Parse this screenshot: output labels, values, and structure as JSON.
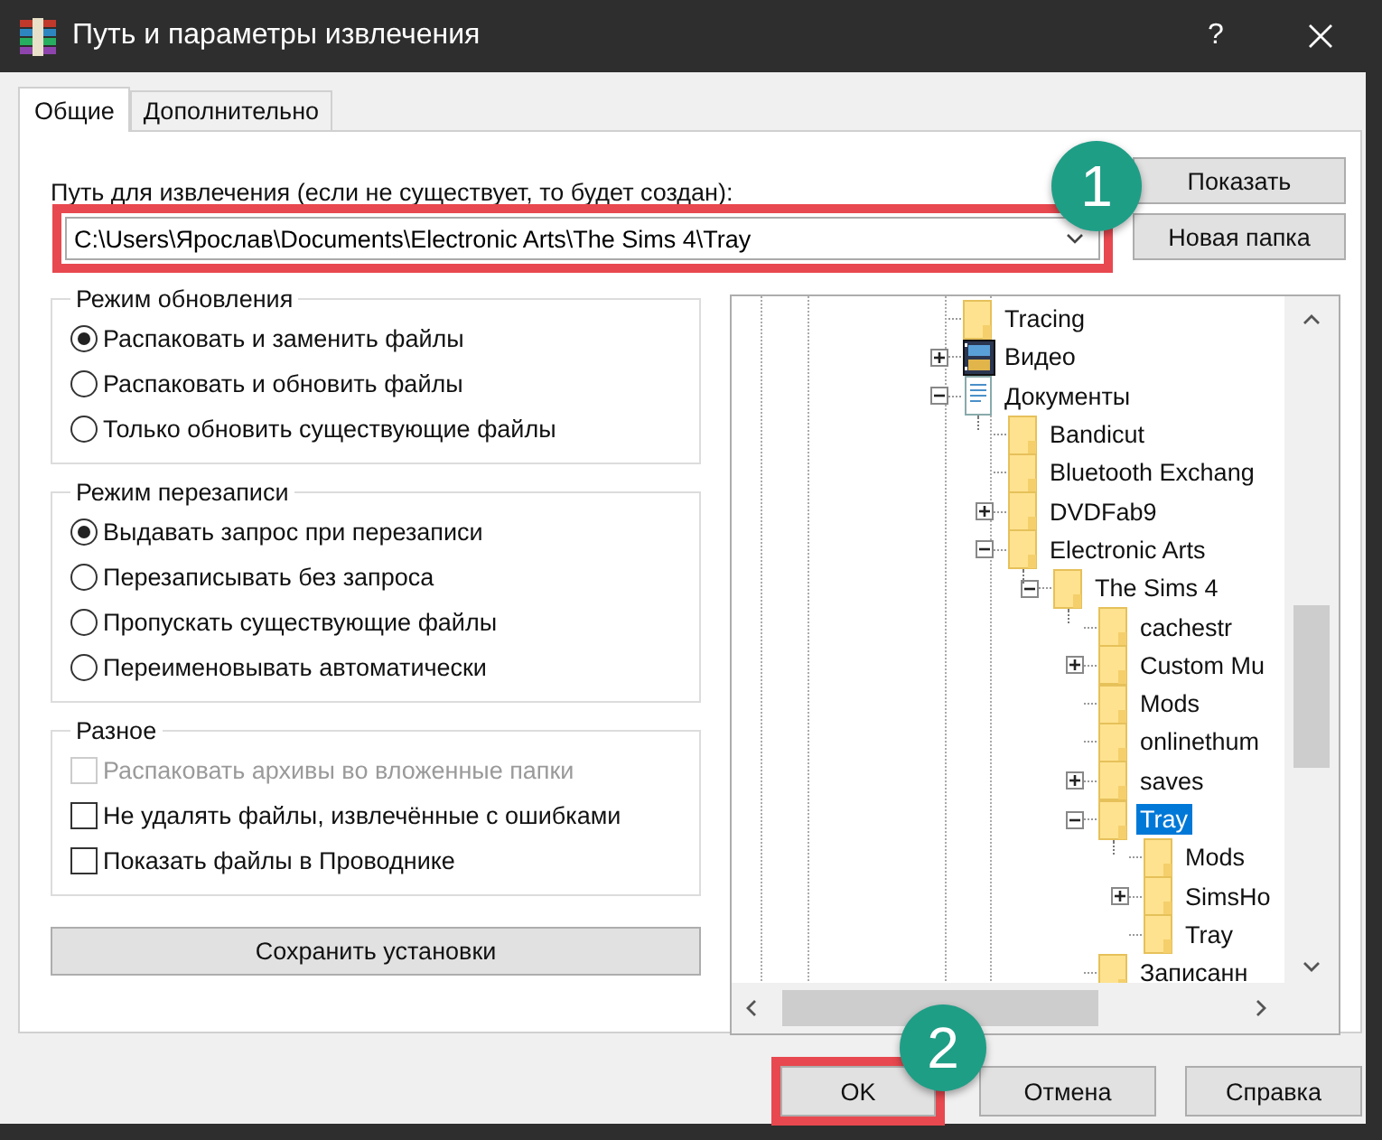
{
  "window": {
    "title": "Путь и параметры извлечения",
    "help_glyph": "?"
  },
  "tabs": [
    {
      "label": "Общие",
      "selected": true
    },
    {
      "label": "Дополнительно",
      "selected": false
    }
  ],
  "path": {
    "label": "Путь для извлечения (если не существует, то будет создан):",
    "value": "C:\\Users\\Ярослав\\Documents\\Electronic Arts\\The Sims 4\\Tray",
    "highlighted": true,
    "annotation": "1"
  },
  "side_buttons": [
    "Показать",
    "Новая папка"
  ],
  "groups": [
    {
      "title": "Режим обновления",
      "options": [
        {
          "kind": "radio",
          "label": "Распаковать и заменить файлы",
          "selected": true
        },
        {
          "kind": "radio",
          "label": "Распаковать и обновить файлы",
          "selected": false
        },
        {
          "kind": "radio",
          "label": "Только обновить существующие файлы",
          "selected": false
        }
      ]
    },
    {
      "title": "Режим перезаписи",
      "options": [
        {
          "kind": "radio",
          "label": "Выдавать запрос при перезаписи",
          "selected": true
        },
        {
          "kind": "radio",
          "label": "Перезаписывать без запроса",
          "selected": false
        },
        {
          "kind": "radio",
          "label": "Пропускать существующие файлы",
          "selected": false
        },
        {
          "kind": "radio",
          "label": "Переименовывать автоматически",
          "selected": false
        }
      ]
    },
    {
      "title": "Разное",
      "options": [
        {
          "kind": "checkbox",
          "label": "Распаковать архивы во вложенные папки",
          "checked": false,
          "disabled": true
        },
        {
          "kind": "checkbox",
          "label": "Не удалять файлы, извлечённые с ошибками",
          "checked": false,
          "disabled": false
        },
        {
          "kind": "checkbox",
          "label": "Показать файлы в Проводнике",
          "checked": false,
          "disabled": false
        }
      ]
    }
  ],
  "save_button": "Сохранить установки",
  "tree": [
    {
      "label": "Tracing",
      "kind": "folder",
      "expandable": false,
      "selected": false
    },
    {
      "label": "Видео",
      "kind": "video",
      "expandable": true,
      "expanded": false,
      "selected": false
    },
    {
      "label": "Документы",
      "kind": "document",
      "expandable": true,
      "expanded": true,
      "selected": false,
      "children": [
        {
          "label": "Bandicut",
          "kind": "folder",
          "expandable": false,
          "selected": false
        },
        {
          "label": "Bluetooth Exchang",
          "kind": "folder",
          "expandable": false,
          "selected": false
        },
        {
          "label": "DVDFab9",
          "kind": "folder",
          "expandable": true,
          "expanded": false,
          "selected": false
        },
        {
          "label": "Electronic Arts",
          "kind": "folder",
          "expandable": true,
          "expanded": true,
          "selected": false,
          "children": [
            {
              "label": "The Sims 4",
              "kind": "folder",
              "expandable": true,
              "expanded": true,
              "selected": false,
              "children": [
                {
                  "label": "cachestr",
                  "kind": "folder",
                  "expandable": false,
                  "selected": false
                },
                {
                  "label": "Custom Mu",
                  "kind": "folder",
                  "expandable": true,
                  "expanded": false,
                  "selected": false
                },
                {
                  "label": "Mods",
                  "kind": "folder",
                  "expandable": false,
                  "selected": false
                },
                {
                  "label": "onlinethum",
                  "kind": "folder",
                  "expandable": false,
                  "selected": false
                },
                {
                  "label": "saves",
                  "kind": "folder",
                  "expandable": true,
                  "expanded": false,
                  "selected": false
                },
                {
                  "label": "Tray",
                  "kind": "folder",
                  "expandable": true,
                  "expanded": true,
                  "selected": true,
                  "children": [
                    {
                      "label": "Mods",
                      "kind": "folder",
                      "expandable": false,
                      "selected": false
                    },
                    {
                      "label": "SimsHo",
                      "kind": "folder",
                      "expandable": true,
                      "expanded": false,
                      "selected": false
                    },
                    {
                      "label": "Tray",
                      "kind": "folder",
                      "expandable": false,
                      "selected": false
                    }
                  ]
                },
                {
                  "label": "Записанн",
                  "kind": "folder",
                  "expandable": false,
                  "selected": false
                }
              ]
            }
          ]
        }
      ]
    }
  ],
  "buttons": [
    {
      "label": "OK",
      "highlighted": true,
      "annotation": "2"
    },
    {
      "label": "Отмена",
      "highlighted": false
    },
    {
      "label": "Справка",
      "highlighted": false
    }
  ]
}
